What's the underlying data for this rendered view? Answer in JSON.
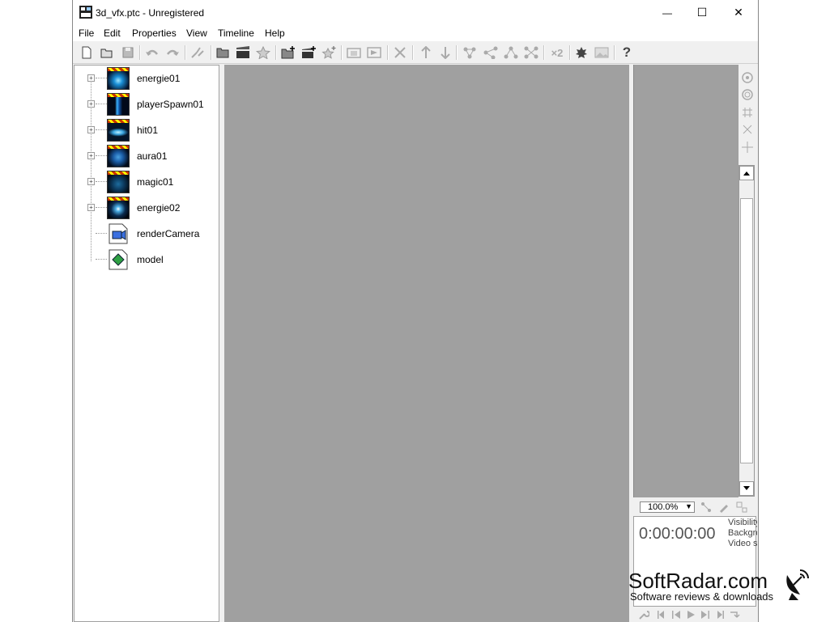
{
  "window": {
    "title": "3d_vfx.ptc - Unregistered",
    "minimize_glyph": "—",
    "maximize_glyph": "☐",
    "close_glyph": "✕"
  },
  "menu": [
    "File",
    "Edit",
    "Properties",
    "View",
    "Timeline",
    "Help"
  ],
  "toolbar": {
    "icons": [
      "new-icon",
      "open-icon",
      "save-icon",
      "undo-icon",
      "redo-icon",
      "link-icon",
      "folder-icon",
      "clapper-icon",
      "star-icon",
      "add-folder-icon",
      "add-clapper-icon",
      "add-star-icon",
      "group-icon",
      "flag-icon",
      "delete-icon",
      "move-up-icon",
      "move-down-icon",
      "network1-icon",
      "network2-icon",
      "network3-icon",
      "network4-icon",
      "x2-icon",
      "leaf-icon",
      "image-icon",
      "help-icon"
    ],
    "x2_label": "×2",
    "help_glyph": "?"
  },
  "tree": {
    "items": [
      {
        "label": "energie01",
        "kind": "effect",
        "color": "#1a8fd6"
      },
      {
        "label": "playerSpawn01",
        "kind": "effect",
        "color": "#1f6fc4"
      },
      {
        "label": "hit01",
        "kind": "effect",
        "color": "#3aa5e0"
      },
      {
        "label": "aura01",
        "kind": "effect",
        "color": "#1b5ea8"
      },
      {
        "label": "magic01",
        "kind": "effect",
        "color": "#2a7fb8"
      },
      {
        "label": "energie02",
        "kind": "effect",
        "color": "#4fb3ea"
      },
      {
        "label": "renderCamera",
        "kind": "camera"
      },
      {
        "label": "model",
        "kind": "model"
      }
    ],
    "expander_glyph": "+"
  },
  "timeline": {
    "zoom": "100.0%",
    "timecode": "0:00:00:00",
    "properties": [
      "Visibility",
      "Background",
      "Video s"
    ]
  },
  "watermark": {
    "title": "SoftRadar.com",
    "subtitle": "Software reviews & downloads"
  }
}
